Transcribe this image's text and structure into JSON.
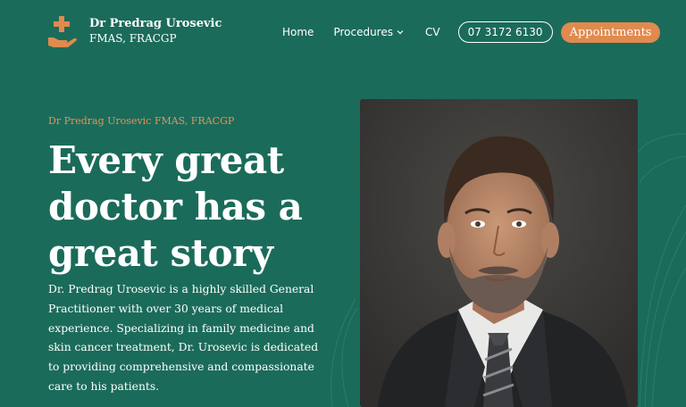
{
  "brand": {
    "name": "Dr Predrag Urosevic",
    "credentials": "FMAS, FRACGP",
    "logo_icon": "hand-cross-icon",
    "accent": "#e08a4e",
    "background": "#1b6b5a"
  },
  "nav": {
    "home": "Home",
    "procedures": "Procedures",
    "procedures_icon": "chevron-down-icon",
    "cv": "CV",
    "phone": "07 3172 6130",
    "appointments": "Appointments"
  },
  "hero": {
    "eyebrow": "Dr Predrag Urosevic FMAS, FRACGP",
    "headline": "Every great doctor has a great story",
    "intro": "Dr. Predrag Urosevic is a highly skilled General Practitioner with over 30 years of medical experience. Specializing in family medicine and skin cancer treatment, Dr. Urosevic is dedicated to providing comprehensive and compassionate care to his patients.",
    "portrait_alt": "Portrait of Dr Predrag Urosevic"
  }
}
